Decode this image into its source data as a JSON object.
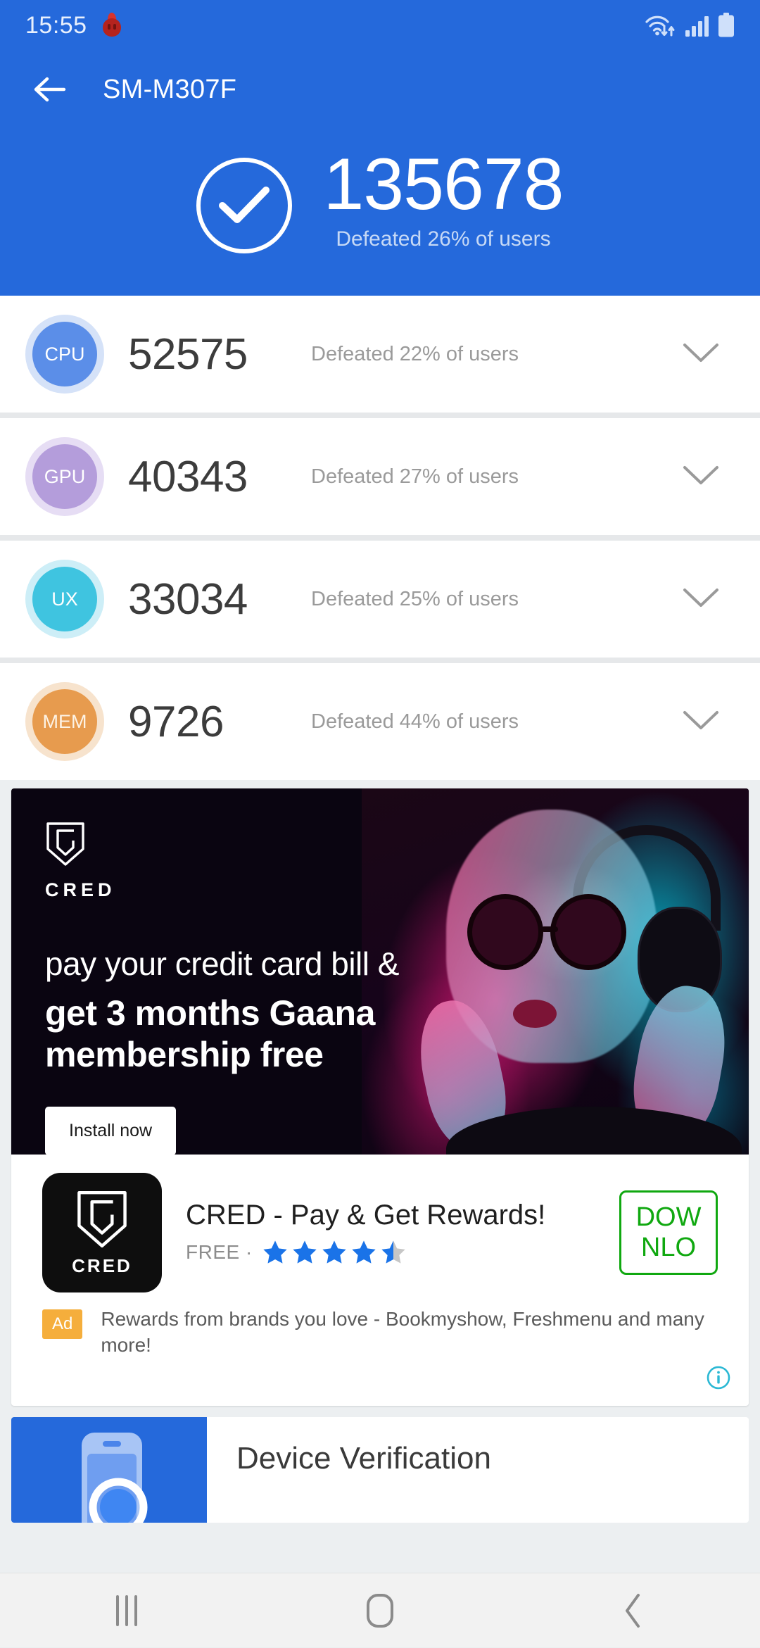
{
  "status_bar": {
    "time": "15:55",
    "emoji_icon": "fire-bulb-icon",
    "wifi_icon": "wifi-transfer-icon",
    "signal_icon": "cellular-signal-icon",
    "battery_icon": "battery-full-icon"
  },
  "app_bar": {
    "back_icon": "arrow-left-icon",
    "title": "SM-M307F"
  },
  "hero": {
    "check_icon": "check-circle-icon",
    "total_score": "135678",
    "subtitle": "Defeated 26% of users"
  },
  "scores": [
    {
      "chip": "CPU",
      "chip_class": "cpu",
      "score": "52575",
      "sub": "Defeated 22% of users",
      "chevron_icon": "chevron-down-icon"
    },
    {
      "chip": "GPU",
      "chip_class": "gpu",
      "score": "40343",
      "sub": "Defeated 27% of users",
      "chevron_icon": "chevron-down-icon"
    },
    {
      "chip": "UX",
      "chip_class": "ux",
      "score": "33034",
      "sub": "Defeated 25% of users",
      "chevron_icon": "chevron-down-icon"
    },
    {
      "chip": "MEM",
      "chip_class": "mem",
      "score": "9726",
      "sub": "Defeated 44% of users",
      "chevron_icon": "chevron-down-icon"
    }
  ],
  "ad": {
    "brand_mark_icon": "cred-shield-icon",
    "brand_text": "CRED",
    "headline_light": "pay your credit card bill &",
    "headline_bold_line1": "get 3 months Gaana",
    "headline_bold_line2": "membership free",
    "install_button": "Install now",
    "app_icon_text": "CRED",
    "app_title": "CRED - Pay & Get Rewards!",
    "price_label": "FREE ·",
    "rating": 4.5,
    "download_button": "DOW NLO",
    "badge": "Ad",
    "disclosure": "Rewards from brands you love - Bookmyshow, Freshmenu and many more!",
    "info_icon": "info-circle-icon",
    "accent_green": "#10a810",
    "badge_color": "#f5ae3c",
    "info_color": "#2bb8d4"
  },
  "device_verification": {
    "thumb_icon": "phone-search-icon",
    "title": "Device Verification"
  },
  "nav_bar": {
    "recents_icon": "recents-icon",
    "home_icon": "home-icon",
    "back_icon": "back-chevron-icon"
  },
  "theme": {
    "primary_blue": "#2569DB",
    "page_bg": "#e6e8ea"
  }
}
